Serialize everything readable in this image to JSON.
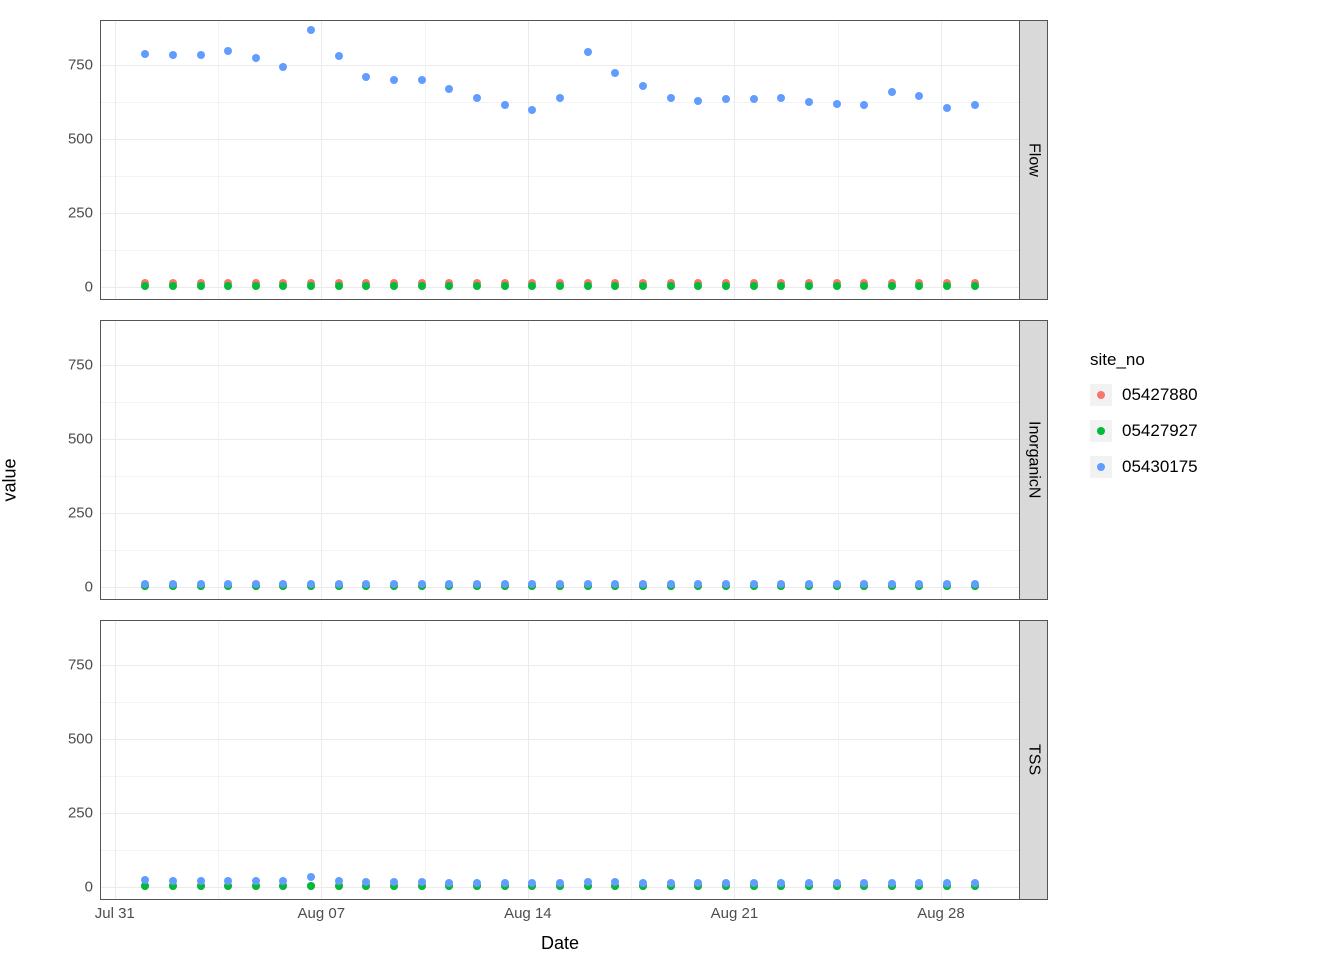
{
  "axes": {
    "xlabel": "Date",
    "ylabel": "value",
    "legend_title": "site_no"
  },
  "legend_colors": [
    "#f8766d",
    "#00ba38",
    "#619cff"
  ],
  "chart_data": [
    {
      "facet": "Flow",
      "type": "scatter",
      "xlabel": "Date",
      "ylabel": "value",
      "ylim": [
        0,
        900
      ],
      "x": [
        "Aug 01",
        "Aug 02",
        "Aug 03",
        "Aug 04",
        "Aug 05",
        "Aug 06",
        "Aug 07",
        "Aug 08",
        "Aug 09",
        "Aug 10",
        "Aug 11",
        "Aug 12",
        "Aug 13",
        "Aug 14",
        "Aug 15",
        "Aug 16",
        "Aug 17",
        "Aug 18",
        "Aug 19",
        "Aug 20",
        "Aug 21",
        "Aug 22",
        "Aug 23",
        "Aug 24",
        "Aug 25",
        "Aug 26",
        "Aug 27",
        "Aug 28",
        "Aug 29",
        "Aug 30",
        "Aug 31"
      ],
      "series": [
        {
          "name": "05427880",
          "values": [
            15,
            15,
            15,
            15,
            15,
            15,
            15,
            15,
            15,
            15,
            15,
            15,
            15,
            15,
            15,
            15,
            15,
            15,
            15,
            15,
            15,
            15,
            15,
            15,
            15,
            15,
            15,
            15,
            15,
            15,
            15
          ]
        },
        {
          "name": "05427927",
          "values": [
            5,
            5,
            5,
            5,
            5,
            5,
            5,
            5,
            5,
            5,
            5,
            5,
            5,
            5,
            5,
            5,
            5,
            5,
            5,
            5,
            5,
            5,
            5,
            5,
            5,
            5,
            5,
            5,
            5,
            5,
            5
          ]
        },
        {
          "name": "05430175",
          "values": [
            790,
            785,
            785,
            800,
            775,
            745,
            870,
            780,
            710,
            700,
            700,
            670,
            640,
            615,
            600,
            640,
            795,
            725,
            680,
            640,
            630,
            635,
            635,
            640,
            625,
            620,
            615,
            660,
            645,
            605,
            615
          ]
        }
      ]
    },
    {
      "facet": "InorganicN",
      "type": "scatter",
      "xlabel": "Date",
      "ylabel": "value",
      "ylim": [
        0,
        900
      ],
      "x": [
        "Aug 01",
        "Aug 02",
        "Aug 03",
        "Aug 04",
        "Aug 05",
        "Aug 06",
        "Aug 07",
        "Aug 08",
        "Aug 09",
        "Aug 10",
        "Aug 11",
        "Aug 12",
        "Aug 13",
        "Aug 14",
        "Aug 15",
        "Aug 16",
        "Aug 17",
        "Aug 18",
        "Aug 19",
        "Aug 20",
        "Aug 21",
        "Aug 22",
        "Aug 23",
        "Aug 24",
        "Aug 25",
        "Aug 26",
        "Aug 27",
        "Aug 28",
        "Aug 29",
        "Aug 30",
        "Aug 31"
      ],
      "series": [
        {
          "name": "05427880",
          "values": [
            3,
            3,
            3,
            3,
            3,
            3,
            3,
            3,
            3,
            3,
            3,
            3,
            3,
            3,
            3,
            3,
            3,
            3,
            3,
            3,
            3,
            3,
            3,
            3,
            3,
            3,
            3,
            3,
            3,
            3,
            3
          ]
        },
        {
          "name": "05427927",
          "values": [
            3,
            3,
            3,
            3,
            3,
            3,
            3,
            3,
            3,
            3,
            3,
            3,
            3,
            3,
            3,
            3,
            3,
            3,
            3,
            3,
            3,
            3,
            3,
            3,
            3,
            3,
            3,
            3,
            3,
            3,
            3
          ]
        },
        {
          "name": "05430175",
          "values": [
            10,
            10,
            10,
            10,
            10,
            10,
            10,
            10,
            10,
            10,
            10,
            10,
            10,
            10,
            10,
            10,
            10,
            10,
            10,
            10,
            10,
            10,
            10,
            10,
            10,
            10,
            10,
            10,
            10,
            10,
            10
          ]
        }
      ]
    },
    {
      "facet": "TSS",
      "type": "scatter",
      "xlabel": "Date",
      "ylabel": "value",
      "ylim": [
        0,
        900
      ],
      "x": [
        "Aug 01",
        "Aug 02",
        "Aug 03",
        "Aug 04",
        "Aug 05",
        "Aug 06",
        "Aug 07",
        "Aug 08",
        "Aug 09",
        "Aug 10",
        "Aug 11",
        "Aug 12",
        "Aug 13",
        "Aug 14",
        "Aug 15",
        "Aug 16",
        "Aug 17",
        "Aug 18",
        "Aug 19",
        "Aug 20",
        "Aug 21",
        "Aug 22",
        "Aug 23",
        "Aug 24",
        "Aug 25",
        "Aug 26",
        "Aug 27",
        "Aug 28",
        "Aug 29",
        "Aug 30",
        "Aug 31"
      ],
      "series": [
        {
          "name": "05427880",
          "values": [
            5,
            5,
            5,
            5,
            5,
            5,
            5,
            5,
            5,
            5,
            5,
            5,
            5,
            5,
            5,
            5,
            5,
            5,
            5,
            5,
            5,
            5,
            5,
            5,
            5,
            5,
            5,
            5,
            5,
            5,
            5
          ]
        },
        {
          "name": "05427927",
          "values": [
            5,
            5,
            5,
            5,
            5,
            5,
            5,
            5,
            5,
            5,
            5,
            5,
            5,
            5,
            5,
            5,
            5,
            5,
            5,
            5,
            5,
            5,
            5,
            5,
            5,
            5,
            5,
            5,
            5,
            5,
            5
          ]
        },
        {
          "name": "05430175",
          "values": [
            25,
            22,
            22,
            22,
            22,
            22,
            35,
            20,
            18,
            18,
            16,
            15,
            15,
            15,
            15,
            15,
            18,
            16,
            15,
            14,
            14,
            14,
            14,
            14,
            13,
            13,
            13,
            14,
            13,
            13,
            13
          ]
        }
      ]
    }
  ],
  "xticks": [
    {
      "label": "Jul 31",
      "frac": 0.015
    },
    {
      "label": "Aug 07",
      "frac": 0.24
    },
    {
      "label": "Aug 14",
      "frac": 0.465
    },
    {
      "label": "Aug 21",
      "frac": 0.69
    },
    {
      "label": "Aug 28",
      "frac": 0.915
    }
  ],
  "yticks": [
    {
      "label": "0",
      "v": 0
    },
    {
      "label": "250",
      "v": 250
    },
    {
      "label": "500",
      "v": 500
    },
    {
      "label": "750",
      "v": 750
    }
  ]
}
